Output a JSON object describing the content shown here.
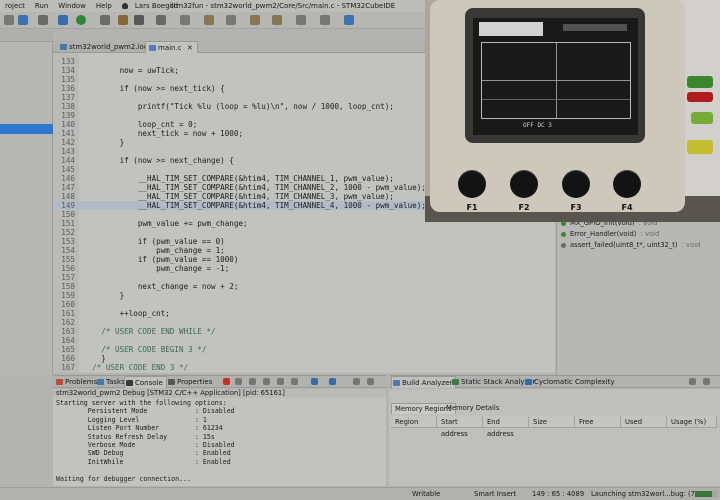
{
  "titlebar": {
    "menu": [
      "roject",
      "Run",
      "Window",
      "Help"
    ],
    "user": "Lars Boegild",
    "window_title": "stm32fun - stm32world_pwm2/Core/Src/main.c - STM32CubeIDE"
  },
  "editor_tabs": [
    {
      "label": "stm32world_pwm2.ioc",
      "icon_color": "#4a78b8"
    },
    {
      "label": "main.c",
      "icon_color": "#5b7fb2",
      "close": "✕"
    }
  ],
  "code_lines": [
    {
      "n": "133",
      "t": ""
    },
    {
      "n": "134",
      "t": "        now = uwTick;"
    },
    {
      "n": "135",
      "t": ""
    },
    {
      "n": "136",
      "t": "        if (now >= next_tick) {"
    },
    {
      "n": "137",
      "t": ""
    },
    {
      "n": "138",
      "t": "            printf(\"Tick %lu (loop = %lu)\\n\", now / 1000, loop_cnt);"
    },
    {
      "n": "139",
      "t": ""
    },
    {
      "n": "140",
      "t": "            loop_cnt = 0;"
    },
    {
      "n": "141",
      "t": "            next_tick = now + 1000;"
    },
    {
      "n": "142",
      "t": "        }"
    },
    {
      "n": "143",
      "t": ""
    },
    {
      "n": "144",
      "t": "        if (now >= next_change) {"
    },
    {
      "n": "145",
      "t": ""
    },
    {
      "n": "146",
      "t": "            __HAL_TIM_SET_COMPARE(&htim4, TIM_CHANNEL_1, pwm_value);"
    },
    {
      "n": "147",
      "t": "            __HAL_TIM_SET_COMPARE(&htim4, TIM_CHANNEL_2, 1000 - pwm_value);"
    },
    {
      "n": "148",
      "t": "            __HAL_TIM_SET_COMPARE(&htim4, TIM_CHANNEL_3, pwm_value);"
    },
    {
      "n": "149",
      "t": "            __HAL_TIM_SET_COMPARE(&htim4, TIM_CHANNEL_4, 1000 - pwm_value);",
      "cur": true
    },
    {
      "n": "150",
      "t": ""
    },
    {
      "n": "151",
      "t": "            pwm_value += pwm_change;"
    },
    {
      "n": "152",
      "t": ""
    },
    {
      "n": "153",
      "t": "            if (pwm_value == 0)"
    },
    {
      "n": "154",
      "t": "                pwm_change = 1;"
    },
    {
      "n": "155",
      "t": "            if (pwm_value == 1000)"
    },
    {
      "n": "156",
      "t": "                pwm_change = -1;"
    },
    {
      "n": "157",
      "t": ""
    },
    {
      "n": "158",
      "t": "            next_change = now + 2;"
    },
    {
      "n": "159",
      "t": "        }"
    },
    {
      "n": "160",
      "t": ""
    },
    {
      "n": "161",
      "t": "        ++loop_cnt;"
    },
    {
      "n": "162",
      "t": ""
    },
    {
      "n": "163",
      "t": "    /* USER CODE END WHILE */",
      "cm": true
    },
    {
      "n": "164",
      "t": ""
    },
    {
      "n": "165",
      "t": "    /* USER CODE BEGIN 3 */",
      "cm": true
    },
    {
      "n": "166",
      "t": "    }"
    },
    {
      "n": "167",
      "t": "  /* USER CODE END 3 */",
      "cm": true
    },
    {
      "n": "168",
      "t": "}"
    }
  ],
  "outline": [
    {
      "label": "MX_GPIO_Init(void)",
      "ret": ": void"
    },
    {
      "label": "Error_Handler(void)",
      "ret": ": void"
    },
    {
      "label": "assert_failed(uint8_t*, uint32_t)",
      "ret": ": void"
    }
  ],
  "device": {
    "buttons": [
      "F1",
      "F2",
      "F3",
      "F4"
    ],
    "lcd_bottom": "OFF DC 3"
  },
  "console": {
    "tabs": [
      "Problems",
      "Tasks",
      "Console",
      "Properties"
    ],
    "active_tab": "Console",
    "title": "stm32world_pwm2 Debug [STM32 C/C++ Application] [pid: 65161]",
    "lines": [
      "Starting server with the following options:",
      "        Persistent Mode            : Disabled",
      "        Logging Level              : 1",
      "        Listen Port Number         : 61234",
      "        Status Refresh Delay       : 15s",
      "        Verbose Mode               : Disabled",
      "        SWD Debug                  : Enabled",
      "        InitWhile                  : Enabled",
      "",
      "Waiting for debugger connection..."
    ]
  },
  "build": {
    "tabs": [
      "Build Analyzer",
      "Static Stack Analyzer",
      "Cyclomatic Complexity"
    ],
    "active_tab": "Build Analyzer",
    "subtabs": [
      "Memory Regions",
      "Memory Details"
    ],
    "columns": [
      "Region",
      "Start address",
      "End address",
      "Size",
      "Free",
      "Used",
      "Usage (%)"
    ]
  },
  "statusbar": {
    "mode": "Writable",
    "insert": "Smart Insert",
    "position": "149 : 65 : 4089",
    "task": "Launching stm32worl...bug: (79%)",
    "progress": 0.79
  }
}
